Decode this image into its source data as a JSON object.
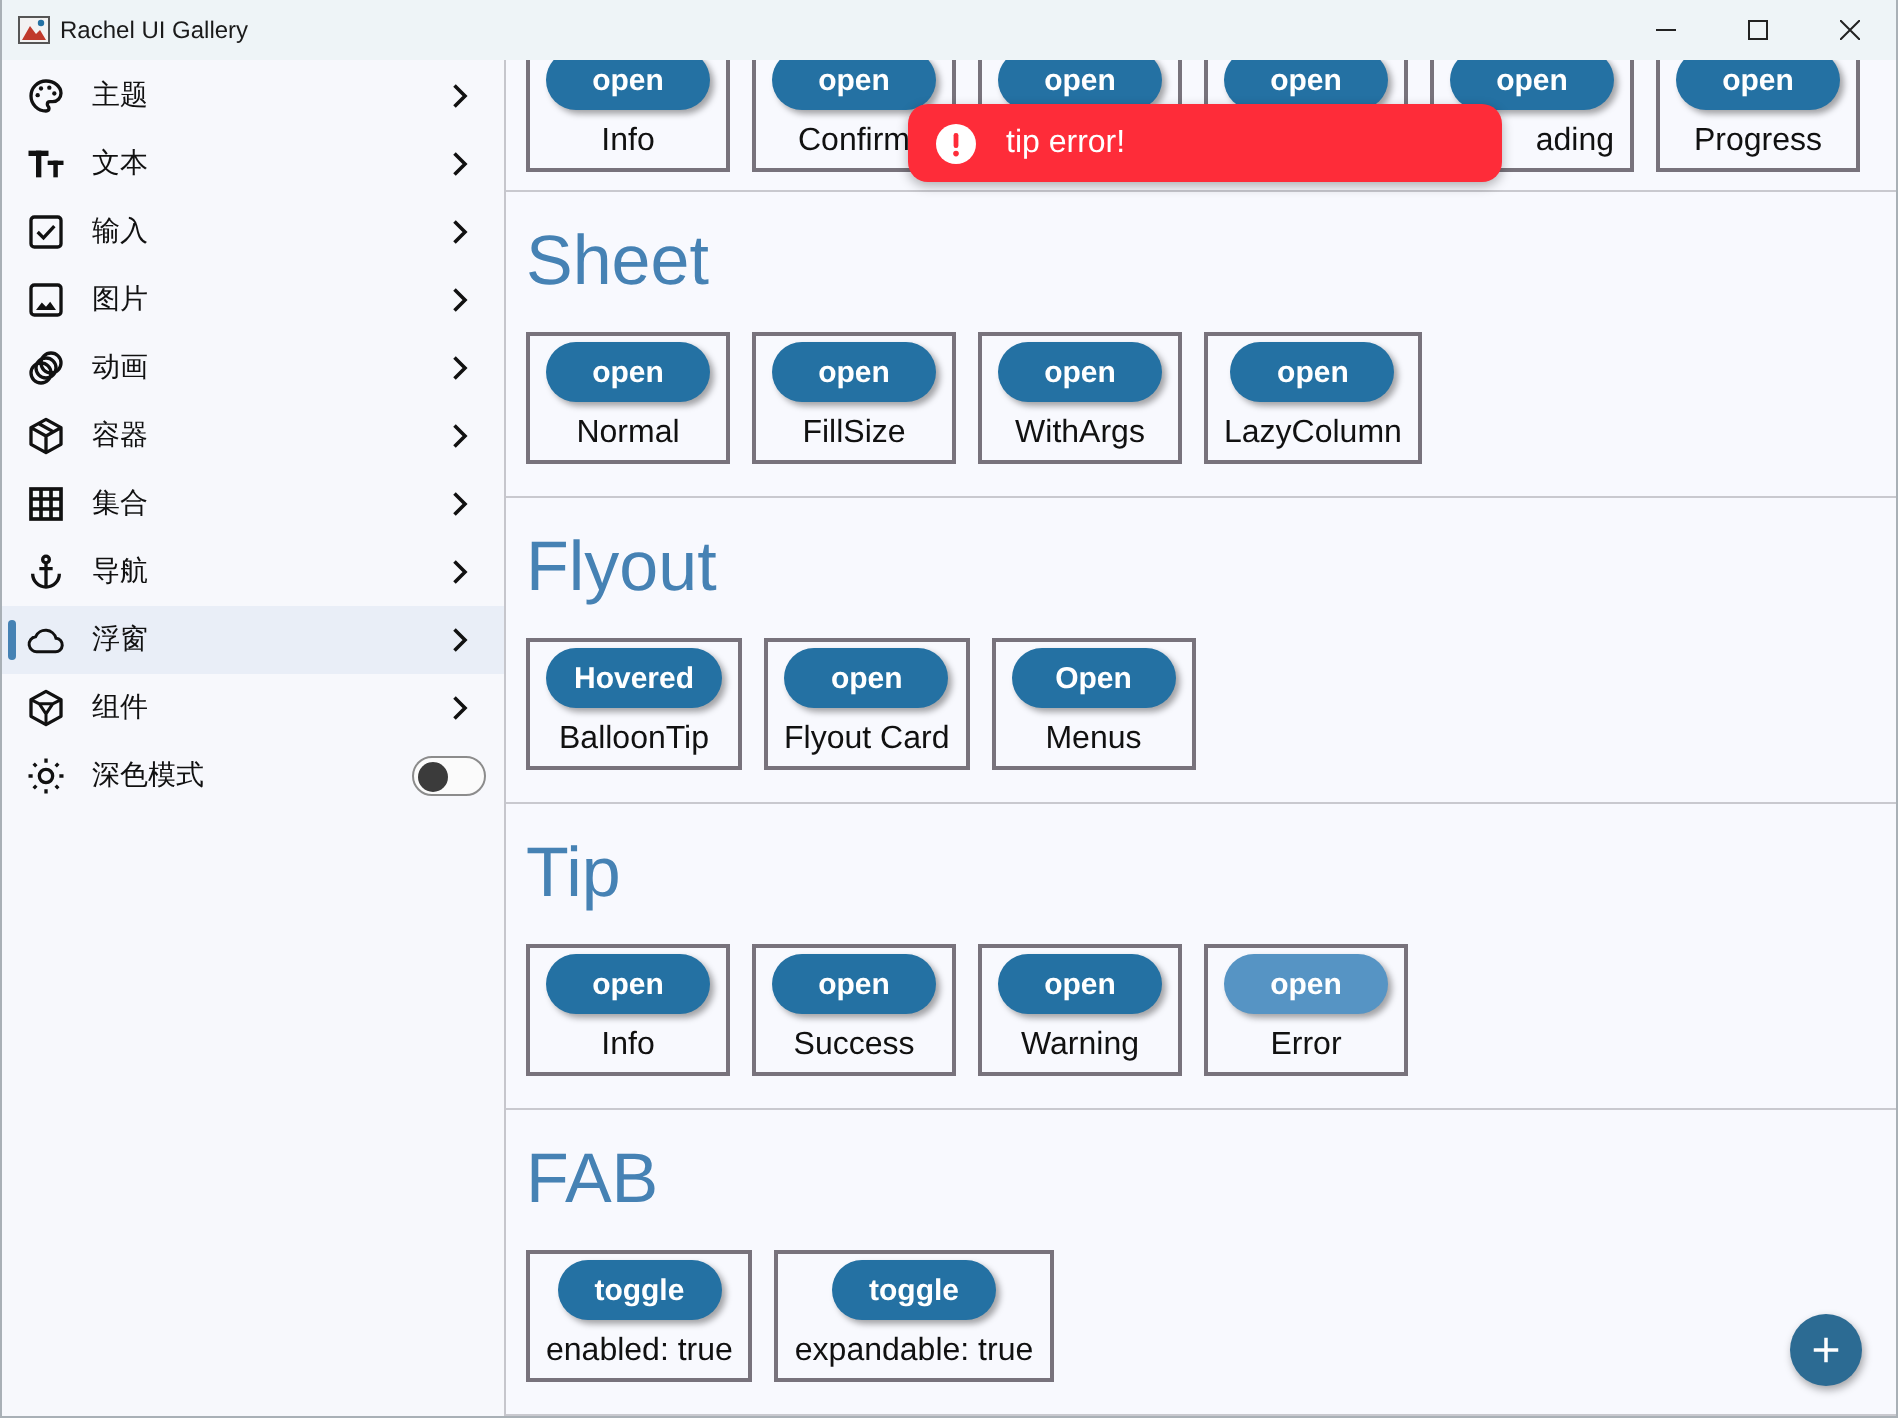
{
  "window": {
    "title": "Rachel UI Gallery"
  },
  "sidebar": {
    "items": [
      {
        "kind": "nav",
        "label": "主题",
        "selected": false
      },
      {
        "kind": "nav",
        "label": "文本",
        "selected": false
      },
      {
        "kind": "nav",
        "label": "输入",
        "selected": false
      },
      {
        "kind": "nav",
        "label": "图片",
        "selected": false
      },
      {
        "kind": "nav",
        "label": "动画",
        "selected": false
      },
      {
        "kind": "nav",
        "label": "容器",
        "selected": false
      },
      {
        "kind": "nav",
        "label": "集合",
        "selected": false
      },
      {
        "kind": "nav",
        "label": "导航",
        "selected": false
      },
      {
        "kind": "nav",
        "label": "浮窗",
        "selected": true
      },
      {
        "kind": "nav",
        "label": "组件",
        "selected": false
      },
      {
        "kind": "toggle",
        "label": "深色模式",
        "on": false
      }
    ]
  },
  "sections": [
    {
      "cards": [
        {
          "button": "open",
          "label": "Info",
          "hovered": false
        },
        {
          "button": "open",
          "label": "Confirm",
          "hovered": false
        },
        {
          "button": "open",
          "hovered": false
        },
        {
          "button": "open",
          "hovered": false
        },
        {
          "button": "open",
          "label": "ading",
          "label_cut": true,
          "hovered": false
        },
        {
          "button": "open",
          "label": "Progress",
          "hovered": false
        }
      ]
    },
    {
      "title": "Sheet",
      "cards": [
        {
          "button": "open",
          "label": "Normal",
          "hovered": false
        },
        {
          "button": "open",
          "label": "FillSize",
          "hovered": false
        },
        {
          "button": "open",
          "label": "WithArgs",
          "hovered": false
        },
        {
          "button": "open",
          "label": "LazyColumn",
          "hovered": false
        }
      ]
    },
    {
      "title": "Flyout",
      "cards": [
        {
          "button": "Hovered",
          "label": "BalloonTip",
          "hovered": false
        },
        {
          "button": "open",
          "label": "Flyout Card",
          "hovered": false
        },
        {
          "button": "Open",
          "label": "Menus",
          "hovered": false
        }
      ]
    },
    {
      "title": "Tip",
      "cards": [
        {
          "button": "open",
          "label": "Info",
          "hovered": false
        },
        {
          "button": "open",
          "label": "Success",
          "hovered": false
        },
        {
          "button": "open",
          "label": "Warning",
          "hovered": false
        },
        {
          "button": "open",
          "label": "Error",
          "hovered": true
        }
      ]
    },
    {
      "title": "FAB",
      "cards": [
        {
          "button": "toggle",
          "label": "enabled: true",
          "hovered": false
        },
        {
          "button": "toggle",
          "label": "expandable: true",
          "hovered": false
        }
      ]
    }
  ],
  "toast": {
    "kind": "error",
    "text": "tip error!"
  }
}
